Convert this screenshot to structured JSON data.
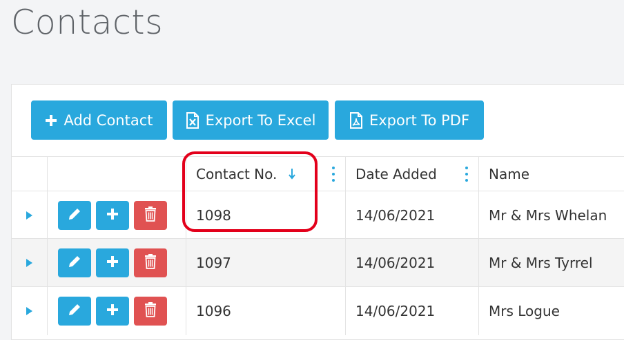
{
  "page": {
    "title": "Contacts"
  },
  "toolbar": {
    "add_label": "Add Contact",
    "excel_label": "Export To Excel",
    "pdf_label": "Export To PDF"
  },
  "grid": {
    "columns": [
      "Contact No.",
      "Date Added",
      "Name"
    ],
    "sort": {
      "column": "Contact No.",
      "direction": "descending"
    },
    "rows": [
      {
        "contact_no": "1098",
        "date_added": "14/06/2021",
        "name": "Mr & Mrs Whelan"
      },
      {
        "contact_no": "1097",
        "date_added": "14/06/2021",
        "name": "Mr & Mrs Tyrrel"
      },
      {
        "contact_no": "1096",
        "date_added": "14/06/2021",
        "name": "Mrs Logue"
      }
    ]
  },
  "colors": {
    "accent": "#29a8dd",
    "danger": "#e05252",
    "highlight": "#e3001b"
  }
}
